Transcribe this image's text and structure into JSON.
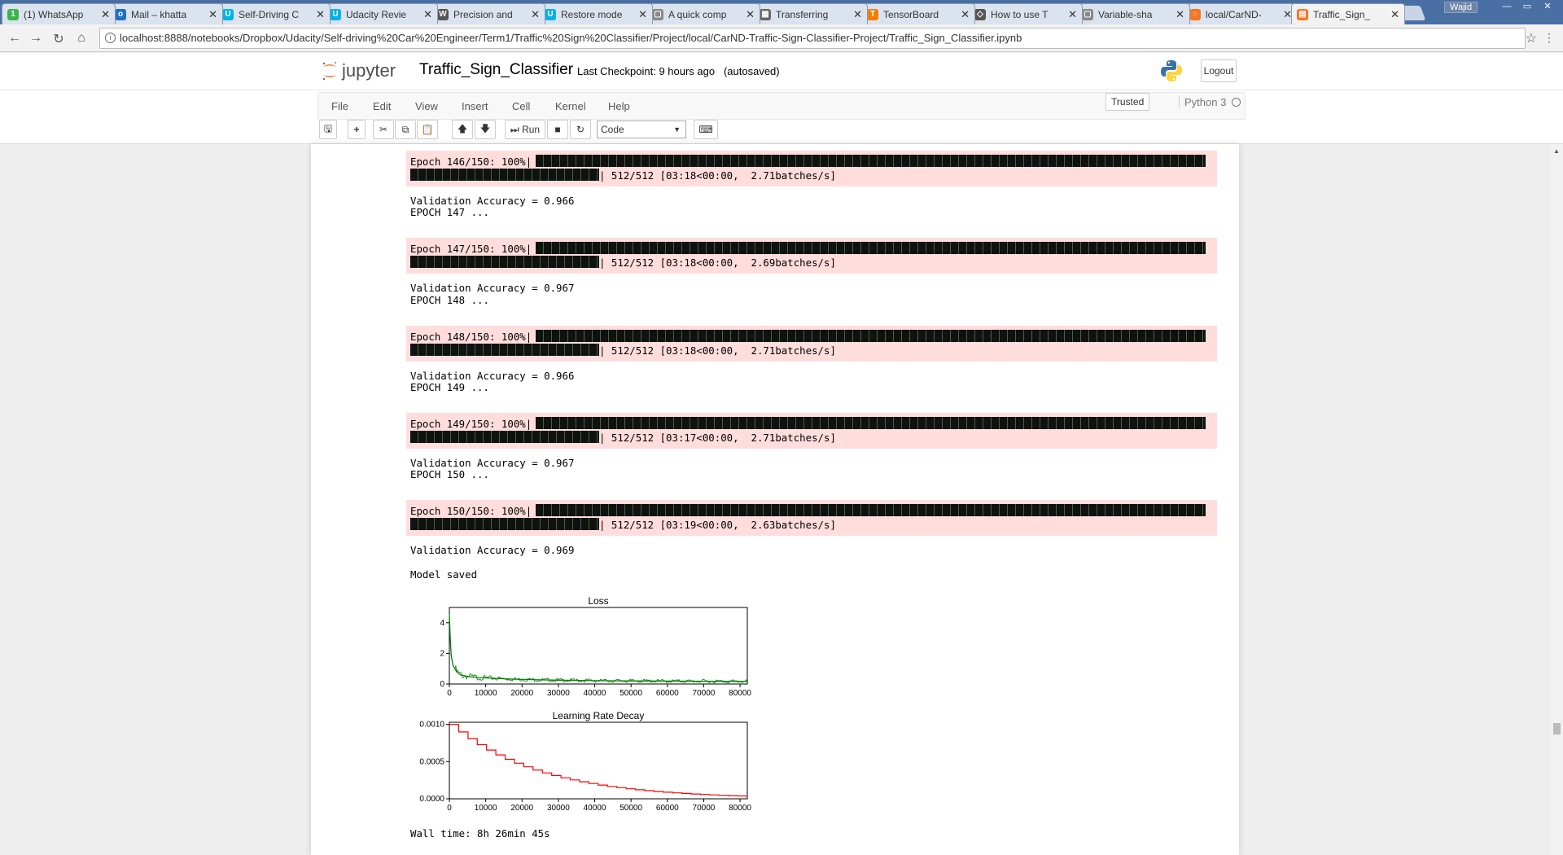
{
  "browser": {
    "tabs": [
      {
        "title": "(1) WhatsApp",
        "icon": "whatsapp-icon",
        "color": "#3bb54a",
        "glyph": "1"
      },
      {
        "title": "Mail – khatta",
        "icon": "outlook-icon",
        "color": "#1f6fc5",
        "glyph": "o"
      },
      {
        "title": "Self-Driving C",
        "icon": "udacity-icon",
        "color": "#02b3e4",
        "glyph": "U"
      },
      {
        "title": "Udacity Revie",
        "icon": "udacity-icon",
        "color": "#02b3e4",
        "glyph": "U"
      },
      {
        "title": "Precision and",
        "icon": "wikipedia-icon",
        "color": "#555555",
        "glyph": "W"
      },
      {
        "title": "Restore mode",
        "icon": "udacity-icon",
        "color": "#02b3e4",
        "glyph": "U"
      },
      {
        "title": "A quick comp",
        "icon": "document-icon",
        "color": "#888888",
        "glyph": "▢"
      },
      {
        "title": "Transferring",
        "icon": "table-icon",
        "color": "#666666",
        "glyph": "▦"
      },
      {
        "title": "TensorBoard",
        "icon": "tensorflow-icon",
        "color": "#f57c00",
        "glyph": "T"
      },
      {
        "title": "How to use T",
        "icon": "diamond-icon",
        "color": "#555555",
        "glyph": "◇"
      },
      {
        "title": "Variable-sha",
        "icon": "document-icon",
        "color": "#888888",
        "glyph": "▢"
      },
      {
        "title": "local/CarND-",
        "icon": "jupyter-icon",
        "color": "#f37626",
        "glyph": "◌"
      },
      {
        "title": "Traffic_Sign_",
        "icon": "notebook-icon",
        "color": "#f37626",
        "glyph": "▤"
      }
    ],
    "active_tab": 12,
    "window_user": "Wajid",
    "url": "localhost:8888/notebooks/Dropbox/Udacity/Self-driving%20Car%20Engineer/Term1/Traffic%20Sign%20Classifier/Project/local/CarND-Traffic-Sign-Classifier-Project/Traffic_Sign_Classifier.ipynb"
  },
  "jupyter": {
    "logo_text": "jupyter",
    "notebook_name": "Traffic_Sign_Classifier",
    "checkpoint": "Last Checkpoint: 9 hours ago",
    "autosave": "(autosaved)",
    "logout": "Logout",
    "menu": [
      "File",
      "Edit",
      "View",
      "Insert",
      "Cell",
      "Kernel",
      "Help"
    ],
    "trusted": "Trusted",
    "kernel_name": "Python 3",
    "run_label": "Run",
    "cell_type": "Code"
  },
  "output": {
    "epochs": [
      {
        "bar": "Epoch 146/150: 100%|",
        "stat": "| 512/512 [03:18<00:00,  2.71batches/s]",
        "acc": "Validation Accuracy = 0.966"
      },
      {
        "header": "EPOCH 147 ...",
        "bar": "Epoch 147/150: 100%|",
        "stat": "| 512/512 [03:18<00:00,  2.69batches/s]",
        "acc": "Validation Accuracy = 0.967"
      },
      {
        "header": "EPOCH 148 ...",
        "bar": "Epoch 148/150: 100%|",
        "stat": "| 512/512 [03:18<00:00,  2.71batches/s]",
        "acc": "Validation Accuracy = 0.966"
      },
      {
        "header": "EPOCH 149 ...",
        "bar": "Epoch 149/150: 100%|",
        "stat": "| 512/512 [03:17<00:00,  2.71batches/s]",
        "acc": "Validation Accuracy = 0.967"
      },
      {
        "header": "EPOCH 150 ...",
        "bar": "Epoch 150/150: 100%|",
        "stat": "| 512/512 [03:19<00:00,  2.63batches/s]",
        "acc": "Validation Accuracy = 0.969"
      }
    ],
    "model_saved": "Model saved",
    "wall_time": "Wall time: 8h 26min 45s"
  },
  "chart_data": [
    {
      "type": "line",
      "title": "Loss",
      "xlim": [
        0,
        82000
      ],
      "ylim": [
        0,
        5
      ],
      "xticks": [
        0,
        10000,
        20000,
        30000,
        40000,
        50000,
        60000,
        70000,
        80000
      ],
      "yticks": [
        0,
        2,
        4
      ],
      "color": "#008000",
      "x": [
        0,
        200,
        500,
        1000,
        2000,
        3000,
        5000,
        8000,
        12000,
        16000,
        20000,
        25000,
        30000,
        40000,
        50000,
        60000,
        70000,
        82000
      ],
      "y": [
        4.6,
        3.2,
        1.9,
        1.2,
        0.8,
        0.6,
        0.5,
        0.42,
        0.38,
        0.33,
        0.3,
        0.27,
        0.25,
        0.22,
        0.2,
        0.19,
        0.18,
        0.17
      ]
    },
    {
      "type": "line",
      "title": "Learning Rate Decay",
      "xlim": [
        0,
        82000
      ],
      "ylim": [
        0,
        0.00103
      ],
      "xticks": [
        0,
        10000,
        20000,
        30000,
        40000,
        50000,
        60000,
        70000,
        80000
      ],
      "yticks": [
        "0.0000",
        "0.0005",
        "0.0010"
      ],
      "ytick_values": [
        0,
        0.0005,
        0.001
      ],
      "color": "#ff0000",
      "step": true,
      "decay_rate": 0.9,
      "decay_steps": 2560,
      "initial": 0.001
    }
  ]
}
